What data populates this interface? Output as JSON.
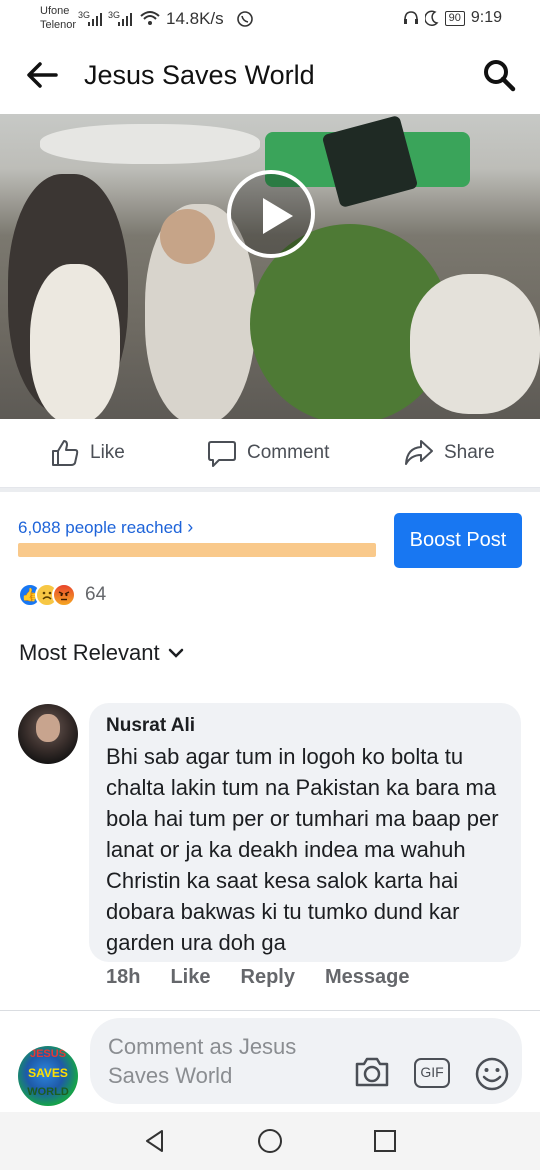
{
  "status_bar": {
    "carrier1": "Ufone",
    "carrier2": "Telenor",
    "sig1": "3G",
    "sig2": "3G",
    "net_speed": "14.8K/s",
    "battery": "90",
    "time": "9:19"
  },
  "header": {
    "title": "Jesus Saves World",
    "back_icon": "arrow-left-icon",
    "search_icon": "search-icon"
  },
  "video": {
    "play_icon": "play-icon"
  },
  "actions": {
    "like": "Like",
    "comment": "Comment",
    "share": "Share"
  },
  "insights": {
    "reached": "6,088 people reached",
    "reach_progress": 1.0,
    "boost_label": "Boost Post"
  },
  "reactions": {
    "count": "64",
    "types": [
      "like",
      "sad",
      "angry"
    ]
  },
  "comments_sort": {
    "label": "Most Relevant"
  },
  "comment": {
    "author": "Nusrat Ali",
    "text": "Bhi sab agar tum in logoh ko bolta tu chalta lakin tum na Pakistan ka bara ma bola hai tum per or tumhari ma baap per lanat or ja ka deakh indea ma wahuh Christin ka saat kesa salok karta hai dobara bakwas ki tu tumko dund kar garden ura doh ga",
    "time": "18h",
    "like": "Like",
    "reply": "Reply",
    "message": "Message"
  },
  "composer": {
    "placeholder": "Comment as Jesus Saves World",
    "page_logo_text": [
      "JESUS",
      "SAVES",
      "WORLD"
    ],
    "camera_icon": "camera-icon",
    "gif_label": "GIF",
    "emoji_icon": "emoji-icon"
  },
  "colors": {
    "accent": "#1877f2",
    "reach_bar": "#f9c98b",
    "link": "#1d63d9"
  }
}
